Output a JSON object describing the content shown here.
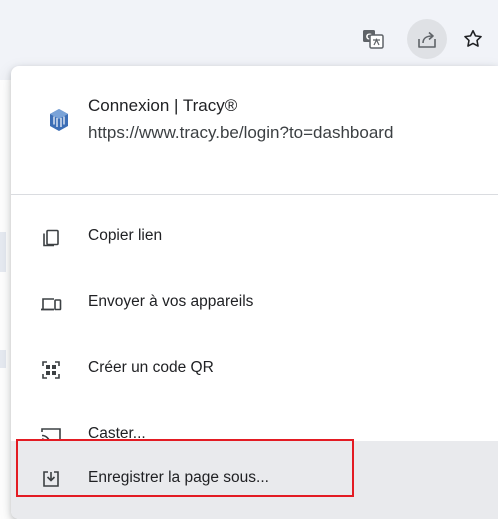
{
  "toolbar": {
    "icons": [
      "translate-icon",
      "share-icon",
      "star-icon"
    ]
  },
  "share_menu": {
    "page_title": "Connexion | Tracy®",
    "page_url": "https://www.tracy.be/login?to=dashboard",
    "items": [
      {
        "label": "Copier lien",
        "icon": "copy-link-icon"
      },
      {
        "label": "Envoyer à vos appareils",
        "icon": "send-to-devices-icon"
      },
      {
        "label": "Créer un code QR",
        "icon": "qr-code-icon"
      },
      {
        "label": "Caster...",
        "icon": "cast-icon"
      },
      {
        "label": "Enregistrer la page sous...",
        "icon": "save-page-icon"
      }
    ],
    "hovered_item": 4
  },
  "colors": {
    "toolbar_bg": "#f1f3f8",
    "share_button_bg": "#dfe1e5",
    "hover_bg": "#e9eaed",
    "highlight": "#e31b23",
    "site_icon": "#3d6fb6"
  }
}
